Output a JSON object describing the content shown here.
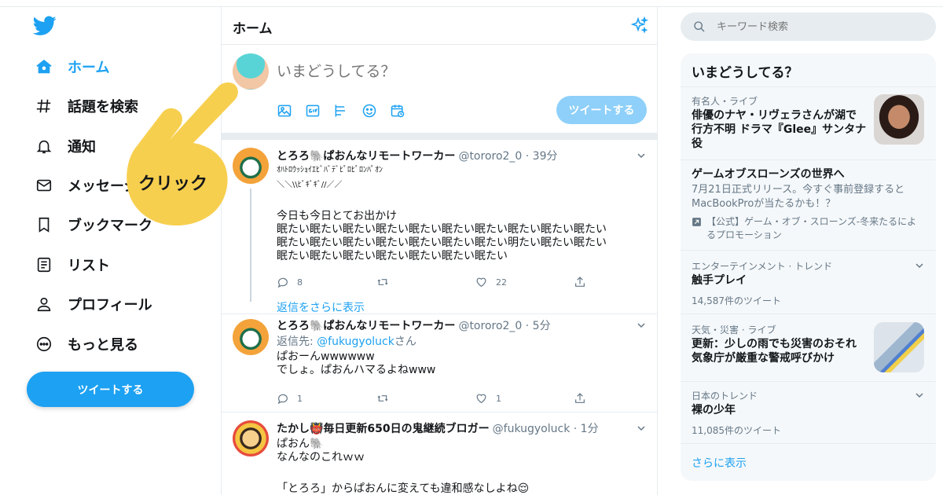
{
  "sidebar": {
    "items": [
      {
        "label": "ホーム",
        "icon": "home-icon",
        "active": true
      },
      {
        "label": "話題を検索",
        "icon": "hashtag-icon"
      },
      {
        "label": "通知",
        "icon": "bell-icon"
      },
      {
        "label": "メッセージ",
        "icon": "mail-icon"
      },
      {
        "label": "ブックマーク",
        "icon": "bookmark-icon"
      },
      {
        "label": "リスト",
        "icon": "list-icon"
      },
      {
        "label": "プロフィール",
        "icon": "person-icon"
      },
      {
        "label": "もっと見る",
        "icon": "more-icon"
      }
    ],
    "tweet_button": "ツイートする"
  },
  "overlay": {
    "label": "クリック"
  },
  "main": {
    "title": "ホーム",
    "composer": {
      "placeholder": "いまどうしてる？",
      "send_label": "ツイートする"
    },
    "tweets": [
      {
        "name": "とろろ🐘ぱおんなリモートワーカー",
        "handle": "@tororo2_0 · 39分",
        "lines_small": [
          "ｵﾊﾄﾛｳｯｼｮｲｴﾋﾞﾊﾞﾃﾞﾋﾟﾛﾋﾟﾛﾝﾊﾟｵﾝ",
          "＼＼\\\\ﾋﾞｷﾞｷﾞ//／／"
        ],
        "lines": [
          "今日も今日とてお出かけ",
          "眠たい眠たい眠たい眠たい眠たい眠たい眠たい眠たい眠たい眠たい",
          "眠たい眠たい眠たい眠たい眠たい眠たい眠たい明たい眠たい眠たい",
          "眠たい眠たい眠たい眠たい眠たい眠たい眠たい"
        ],
        "reply_count": "8",
        "like_count": "22"
      },
      {
        "name": "とろろ🐘ぱおんなリモートワーカー",
        "handle": "@tororo2_0 · 5分",
        "reply_prefix": "返信先: ",
        "reply_mention": "@fukugyoluck",
        "reply_suffix": "さん",
        "lines": [
          "ぱおーんwwwwww",
          "でしょ。ぱおんハマるよねwww"
        ],
        "reply_count": "1",
        "like_count": "1"
      },
      {
        "name": "たかし👹毎日更新650日の鬼継続ブロガー",
        "handle": "@fukugyoluck · 1分",
        "lines": [
          "ぱおん🐘",
          "なんなのこれｗｗ",
          "",
          "「とろろ」からぱおんに変えても違和感なしよね😌"
        ]
      }
    ],
    "show_replies": "返信をさらに表示"
  },
  "search": {
    "placeholder": "キーワード検索"
  },
  "trends": {
    "title": "いまどうしてる？",
    "items": [
      {
        "meta": "有名人・ライブ",
        "headline_lines": [
          "俳優のナヤ・リヴェラさんが湖で",
          "行方不明 ドラマ『Glee』サンタナ",
          "役"
        ],
        "thumb": "person-photo"
      },
      {
        "headline": "ゲームオブスローンズの世界へ",
        "desc_lines": [
          "7月21日正式リリース。今すぐ事前登録すると",
          "MacBookProが当たるかも！？"
        ],
        "promo_lines": [
          "【公式】ゲーム・オブ・スローンズ-冬来たるによ",
          "るプロモーション"
        ],
        "promo_icon": "promoted-icon"
      },
      {
        "meta": "エンターテインメント · トレンド",
        "headline": "触手プレイ",
        "count": "14,587件のツイート"
      },
      {
        "meta": "天気・災害 · ライブ",
        "headline_lines": [
          "更新：少しの雨でも災害のおそれ",
          "気象庁が厳重な警戒呼びかけ"
        ],
        "thumb": "weather-map"
      },
      {
        "meta": "日本のトレンド",
        "headline": "裸の少年",
        "count": "11,085件のツイート"
      }
    ],
    "show_more": "さらに表示"
  },
  "colors": {
    "accent": "#1da1f2",
    "accent_disabled": "#8ed0f9",
    "overlay_hand": "#f7cf4f"
  }
}
